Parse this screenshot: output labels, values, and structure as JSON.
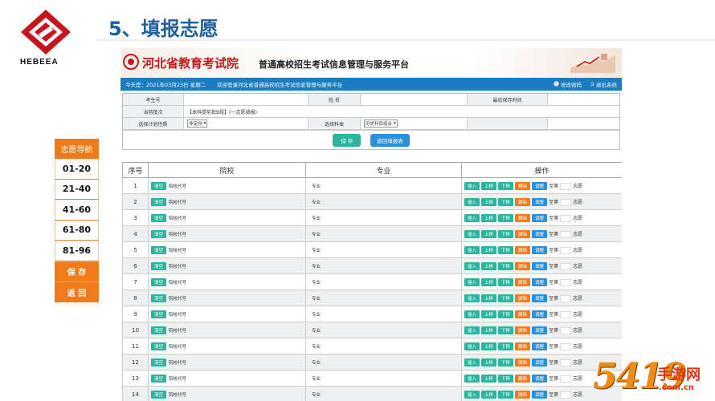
{
  "slide": {
    "logo_text": "HEBEEA",
    "title": "5、填报志愿"
  },
  "app": {
    "banner_name": "河北省教育考试院",
    "banner_subtitle": "普通高校招生考试信息管理与服务平台",
    "nav": {
      "date": "今天是：2021年03月23日 星期二",
      "welcome": "欢迎登录河北省普通高校招生考试信息管理与服务平台",
      "change_password": "修改密码",
      "logout": "退出系统"
    },
    "form": {
      "exam_no_label": "考生号",
      "name_label": "姓 名",
      "last_saved_label": "最后保存时间",
      "batch_label": "当前批次",
      "batch_value": "【本科提前批B段】(一志愿填报)",
      "plan_label": "选择计划性质",
      "plan_value": "非定向",
      "subject_label": "选择科类",
      "subject_value": "历史科目组合",
      "save_button": "保 存",
      "back_button": "返回填报表"
    },
    "table": {
      "headers": {
        "seq": "序号",
        "school": "院校",
        "major": "专业",
        "ops": "操作"
      },
      "clear_label": "清空",
      "code_placeholder": "院校代号",
      "major_placeholder": "专业",
      "op_labels": {
        "insert": "插入",
        "up": "上移",
        "down": "下移",
        "delete": "删除",
        "adjust": "调整",
        "to": "至第",
        "unit": "志愿"
      },
      "rows": [
        "1",
        "2",
        "3",
        "4",
        "5",
        "6",
        "7",
        "8",
        "9",
        "10",
        "11",
        "12",
        "13",
        "14"
      ]
    }
  },
  "sidenav": {
    "header": "志愿导航",
    "items": [
      "01-20",
      "21-40",
      "41-60",
      "61-80",
      "81-96"
    ],
    "save": "保 存",
    "back": "返 回"
  },
  "watermark": {
    "number": "5419",
    "cn": "手游网",
    "url": ".com.cn"
  },
  "colors": {
    "title_blue": "#1f5f9e",
    "nav_blue": "#1a7cc1",
    "brand_red": "#c4161c",
    "accent_orange": "#f07b18",
    "button_teal": "#2bb5a0"
  }
}
